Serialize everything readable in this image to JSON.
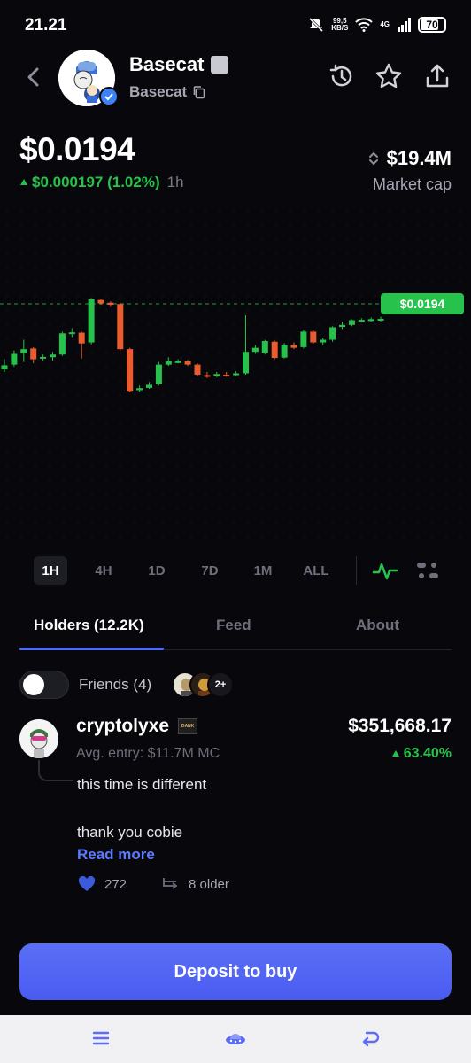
{
  "status_bar": {
    "time": "21.21",
    "net_speed": "99,5",
    "net_unit": "KB/S",
    "net_type": "4G",
    "battery": "70"
  },
  "header": {
    "token_name": "Basecat",
    "token_ticker": "Basecat",
    "icons": [
      "back-icon",
      "history-icon",
      "star-icon",
      "share-icon"
    ]
  },
  "price": {
    "value": "$0.0194",
    "change": "$0.000197 (1.02%)",
    "period": "1h",
    "market_cap": "$19.4M",
    "market_cap_label": "Market cap",
    "up_color": "#27c24c",
    "down_color": "#ec5b2d"
  },
  "chart_data": {
    "type": "candlestick",
    "last_price_label": "$0.0194",
    "candles": [
      {
        "o": 0.492,
        "c": 0.48,
        "h": 0.462,
        "l": 0.5
      },
      {
        "o": 0.478,
        "c": 0.446,
        "h": 0.436,
        "l": 0.484
      },
      {
        "o": 0.444,
        "c": 0.432,
        "h": 0.404,
        "l": 0.47
      },
      {
        "o": 0.43,
        "c": 0.462,
        "h": 0.426,
        "l": 0.474
      },
      {
        "o": 0.46,
        "c": 0.455,
        "h": 0.448,
        "l": 0.466
      },
      {
        "o": 0.456,
        "c": 0.448,
        "h": 0.44,
        "l": 0.466
      },
      {
        "o": 0.448,
        "c": 0.385,
        "h": 0.38,
        "l": 0.452
      },
      {
        "o": 0.387,
        "c": 0.382,
        "h": 0.37,
        "l": 0.396
      },
      {
        "o": 0.383,
        "c": 0.415,
        "h": 0.38,
        "l": 0.46
      },
      {
        "o": 0.412,
        "c": 0.284,
        "h": 0.28,
        "l": 0.418
      },
      {
        "o": 0.286,
        "c": 0.296,
        "h": 0.282,
        "l": 0.3
      },
      {
        "o": 0.294,
        "c": 0.3,
        "h": 0.29,
        "l": 0.306
      },
      {
        "o": 0.298,
        "c": 0.432,
        "h": 0.294,
        "l": 0.436
      },
      {
        "o": 0.432,
        "c": 0.556,
        "h": 0.428,
        "l": 0.56
      },
      {
        "o": 0.554,
        "c": 0.548,
        "h": 0.54,
        "l": 0.558
      },
      {
        "o": 0.547,
        "c": 0.538,
        "h": 0.53,
        "l": 0.55
      },
      {
        "o": 0.536,
        "c": 0.478,
        "h": 0.47,
        "l": 0.54
      },
      {
        "o": 0.478,
        "c": 0.468,
        "h": 0.456,
        "l": 0.482
      },
      {
        "o": 0.468,
        "c": 0.468,
        "h": 0.462,
        "l": 0.474
      },
      {
        "o": 0.468,
        "c": 0.478,
        "h": 0.464,
        "l": 0.482
      },
      {
        "o": 0.478,
        "c": 0.508,
        "h": 0.474,
        "l": 0.512
      },
      {
        "o": 0.509,
        "c": 0.512,
        "h": 0.5,
        "l": 0.518
      },
      {
        "o": 0.512,
        "c": 0.506,
        "h": 0.5,
        "l": 0.516
      },
      {
        "o": 0.508,
        "c": 0.51,
        "h": 0.5,
        "l": 0.514
      },
      {
        "o": 0.507,
        "c": 0.504,
        "h": 0.498,
        "l": 0.512
      },
      {
        "o": 0.504,
        "c": 0.44,
        "h": 0.332,
        "l": 0.508
      },
      {
        "o": 0.44,
        "c": 0.428,
        "h": 0.42,
        "l": 0.446
      },
      {
        "o": 0.444,
        "c": 0.408,
        "h": 0.404,
        "l": 0.448
      },
      {
        "o": 0.41,
        "c": 0.458,
        "h": 0.406,
        "l": 0.462
      },
      {
        "o": 0.457,
        "c": 0.42,
        "h": 0.414,
        "l": 0.46
      },
      {
        "o": 0.42,
        "c": 0.428,
        "h": 0.412,
        "l": 0.432
      },
      {
        "o": 0.426,
        "c": 0.38,
        "h": 0.374,
        "l": 0.43
      },
      {
        "o": 0.38,
        "c": 0.412,
        "h": 0.376,
        "l": 0.416
      },
      {
        "o": 0.412,
        "c": 0.404,
        "h": 0.398,
        "l": 0.42
      },
      {
        "o": 0.404,
        "c": 0.367,
        "h": 0.364,
        "l": 0.41
      },
      {
        "o": 0.366,
        "c": 0.36,
        "h": 0.35,
        "l": 0.372
      },
      {
        "o": 0.36,
        "c": 0.346,
        "h": 0.344,
        "l": 0.364
      },
      {
        "o": 0.346,
        "c": 0.345,
        "h": 0.34,
        "l": 0.35
      },
      {
        "o": 0.345,
        "c": 0.343,
        "h": 0.338,
        "l": 0.35
      },
      {
        "o": 0.344,
        "c": 0.342,
        "h": 0.336,
        "l": 0.35
      }
    ]
  },
  "timeframes": {
    "options": [
      "1H",
      "4H",
      "1D",
      "7D",
      "1M",
      "ALL"
    ],
    "active": "1H"
  },
  "tabs": {
    "holders": "Holders (12.2K)",
    "feed": "Feed",
    "about": "About"
  },
  "friends": {
    "label": "Friends (4)",
    "more": "2+"
  },
  "holder": {
    "name": "cryptolyxe",
    "badge": "DANK",
    "entry": "Avg. entry: $11.7M MC",
    "value": "$351,668.17",
    "pct": "63.40%",
    "comment_line1": "this time is different",
    "comment_line2": "thank you cobie",
    "read_more": "Read more",
    "likes": "272",
    "replies": "8 older"
  },
  "cta": {
    "deposit": "Deposit to buy"
  }
}
